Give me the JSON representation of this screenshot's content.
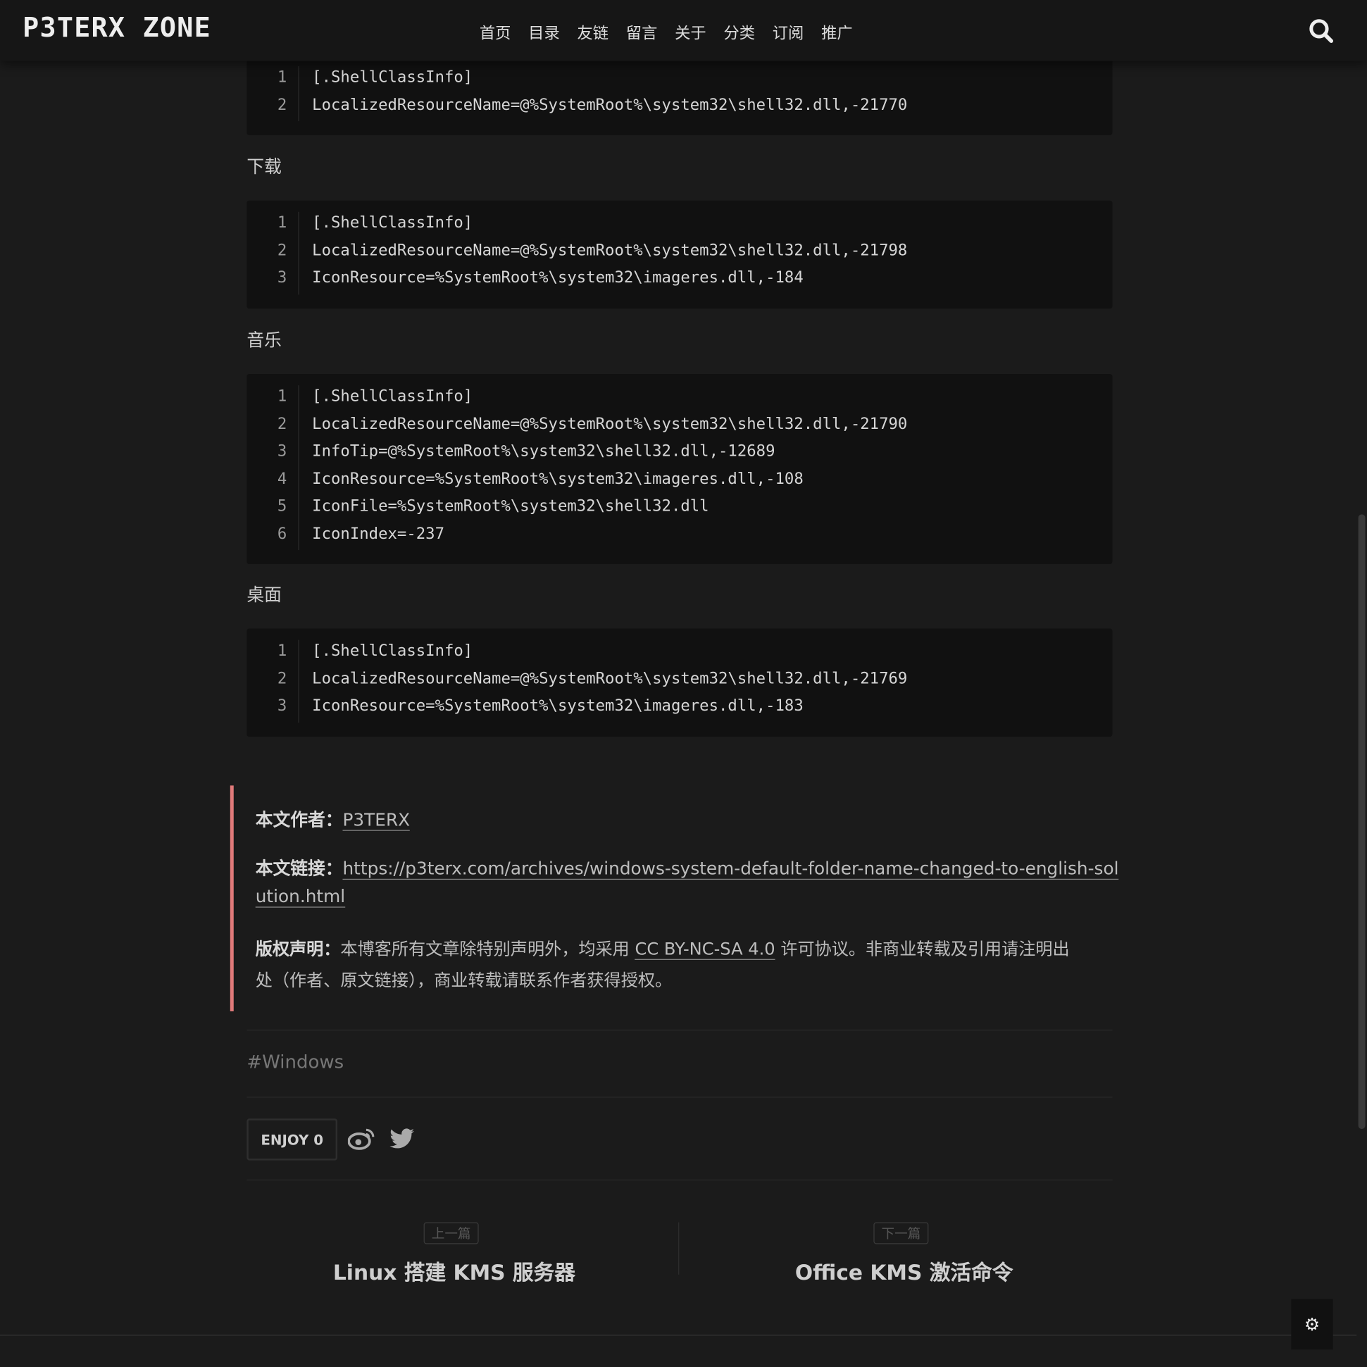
{
  "header": {
    "logo": "P3TERX ZONE",
    "nav": [
      "首页",
      "目录",
      "友链",
      "留言",
      "关于",
      "分类",
      "订阅",
      "推广"
    ],
    "search_icon": "search-icon"
  },
  "blocks": [
    {
      "heading": "",
      "lines": [
        "[.ShellClassInfo]",
        "LocalizedResourceName=@%SystemRoot%\\system32\\shell32.dll,-21770"
      ]
    },
    {
      "heading": "下载",
      "lines": [
        "[.ShellClassInfo]",
        "LocalizedResourceName=@%SystemRoot%\\system32\\shell32.dll,-21798",
        "IconResource=%SystemRoot%\\system32\\imageres.dll,-184"
      ]
    },
    {
      "heading": "音乐",
      "lines": [
        "[.ShellClassInfo]",
        "LocalizedResourceName=@%SystemRoot%\\system32\\shell32.dll,-21790",
        "InfoTip=@%SystemRoot%\\system32\\shell32.dll,-12689",
        "IconResource=%SystemRoot%\\system32\\imageres.dll,-108",
        "IconFile=%SystemRoot%\\system32\\shell32.dll",
        "IconIndex=-237"
      ]
    },
    {
      "heading": "桌面",
      "lines": [
        "[.ShellClassInfo]",
        "LocalizedResourceName=@%SystemRoot%\\system32\\shell32.dll,-21769",
        "IconResource=%SystemRoot%\\system32\\imageres.dll,-183"
      ]
    }
  ],
  "copyright": {
    "author_label": "本文作者：",
    "author": "P3TERX",
    "link_label": "本文链接：",
    "link_1": "https://p3terx.com/archives/windows-system-default-folder-name-changed-to-english-sol",
    "link_2": "ution.html",
    "license_label": "版权声明：",
    "license_pre": "本博客所有文章除特别声明外，均采用 ",
    "license": "CC BY-NC-SA 4.0",
    "license_post": " 许可协议。非商业转载及引用请注明出",
    "license_line2": "处（作者、原文链接），商业转载请联系作者获得授权。",
    "accent": "#e07a7a"
  },
  "tag": "#Windows",
  "enjoy": "ENJOY 0",
  "share": [
    "weibo-icon",
    "twitter-icon"
  ],
  "prev": {
    "label": "上一篇",
    "title": "Linux 搭建 KMS 服务器"
  },
  "next": {
    "label": "下一篇",
    "title": "Office KMS 激活命令"
  }
}
